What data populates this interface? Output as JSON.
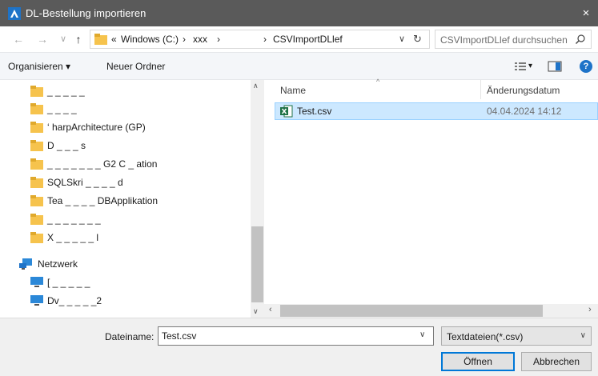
{
  "window": {
    "title": "DL-Bestellung importieren",
    "close_glyph": "×"
  },
  "nav_buttons": {
    "back_glyph": "←",
    "forward_glyph": "→",
    "up_glyph": "↑"
  },
  "address": {
    "crumbs": [
      "«",
      "Windows (C:)",
      "›",
      "xxx",
      "›",
      "›",
      "CSVImportDLlef"
    ],
    "dropdown_glyph": "∨",
    "refresh_glyph": "↻"
  },
  "search": {
    "placeholder": "CSVImportDLlef durchsuchen",
    "icon": "search-icon"
  },
  "toolbar": {
    "organize": "Organisieren ▾",
    "new_folder": "Neuer Ordner",
    "view_glyph": "▾",
    "help_glyph": "?"
  },
  "nav_pane": {
    "folders": [
      {
        "label": "_ _ _ _ _"
      },
      {
        "label": "_ _ _ _"
      },
      {
        "label": "‘ harpArchitecture (GP)"
      },
      {
        "label": "D _ _ _ s"
      },
      {
        "label": "_ _ _ _ _ _ _ G2 C _ ation"
      },
      {
        "label": "SQLSkri _ _ _ _ d"
      },
      {
        "label": "Tea _ _ _ _ DBApplikation"
      },
      {
        "label": "_ _ _ _ _ _ _"
      },
      {
        "label": "X _ _ _ _ _ l"
      }
    ],
    "network_label": "Netzwerk",
    "computers": [
      {
        "label": "[ _ _ _ _ _"
      },
      {
        "label": "Dv_ _ _ _ _2"
      }
    ]
  },
  "file_pane": {
    "columns": {
      "name": "Name",
      "date": "Änderungsdatum"
    },
    "files": [
      {
        "name": "Test.csv",
        "modified": "04.04.2024 14:12"
      }
    ]
  },
  "bottom": {
    "filename_label": "Dateiname:",
    "filename_value": "Test.csv",
    "filter_value": "Textdateien(*.csv)",
    "dropdown_glyph": "∨",
    "open_button": "Öffnen",
    "cancel_button": "Abbrechen"
  },
  "colors": {
    "titlebar": "#5a5a5a",
    "accent": "#1e73c8",
    "selection": "#cce8ff",
    "folder": "#f6c34d"
  }
}
